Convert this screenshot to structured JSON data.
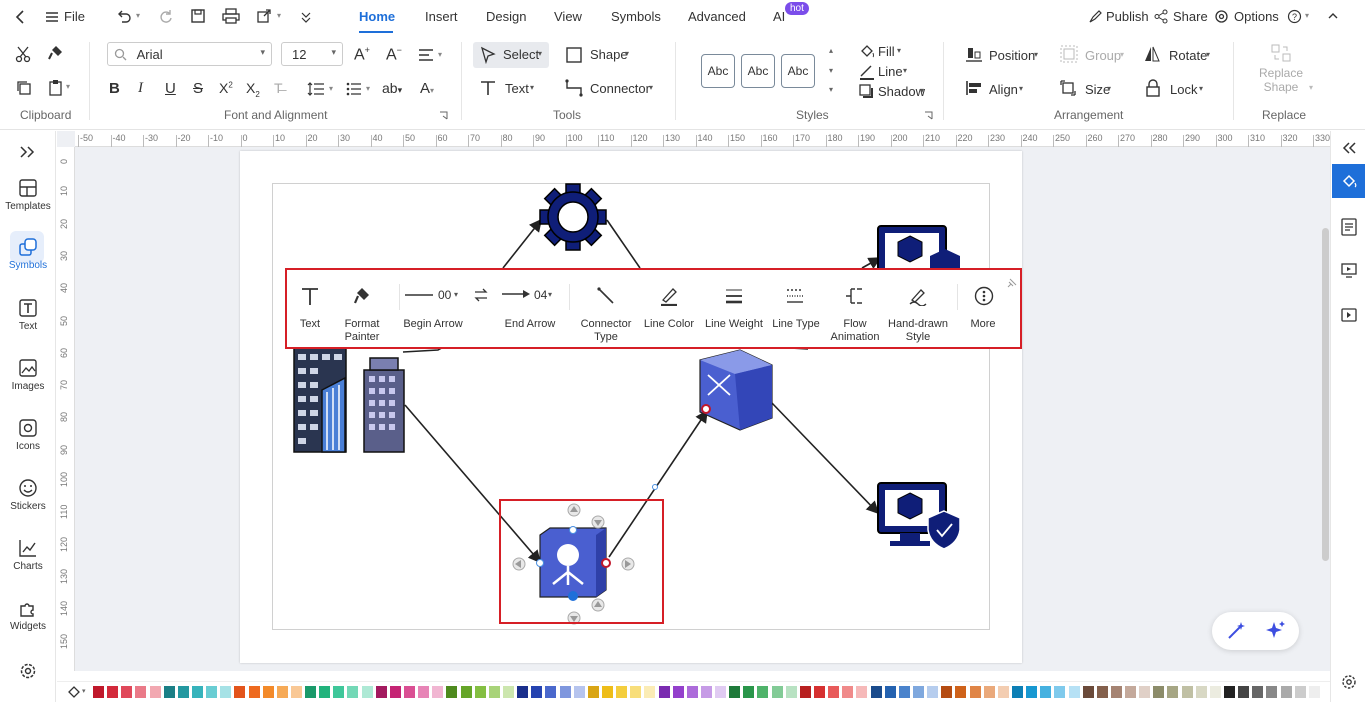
{
  "menubar": {
    "file": "File",
    "tabs": [
      "Home",
      "Insert",
      "Design",
      "View",
      "Symbols",
      "Advanced",
      "AI"
    ],
    "ai_badge": "hot",
    "publish": "Publish",
    "share": "Share",
    "options": "Options"
  },
  "ribbon": {
    "groups": [
      "Clipboard",
      "Font and Alignment",
      "Tools",
      "Styles",
      "Arrangement",
      "Replace"
    ],
    "font_family": "Arial",
    "font_size": "12",
    "select": "Select",
    "shape": "Shape",
    "text": "Text",
    "connector": "Connector",
    "style_sample": "Abc",
    "fill": "Fill",
    "line": "Line",
    "shadow": "Shadow",
    "position": "Position",
    "group": "Group",
    "rotate": "Rotate",
    "align": "Align",
    "size": "Size",
    "lock": "Lock",
    "replace_shape": "Replace Shape"
  },
  "leftbar": [
    "Templates",
    "Symbols",
    "Text",
    "Images",
    "Icons",
    "Stickers",
    "Charts",
    "Widgets"
  ],
  "ruler": {
    "h": [
      "-50",
      "-40",
      "-30",
      "-20",
      "-10",
      "0",
      "10",
      "20",
      "30",
      "40",
      "50",
      "60",
      "70",
      "80",
      "90",
      "100",
      "110",
      "120",
      "130",
      "140",
      "150",
      "160",
      "170",
      "180",
      "190",
      "200",
      "210",
      "220",
      "230",
      "240",
      "250",
      "260",
      "270",
      "280",
      "290",
      "300",
      "310",
      "320",
      "330"
    ],
    "v": [
      "0",
      "10",
      "20",
      "30",
      "40",
      "50",
      "60",
      "70",
      "80",
      "90",
      "100",
      "110",
      "120",
      "130",
      "140",
      "150"
    ]
  },
  "floatbar": {
    "text": "Text",
    "format_painter": "Format Painter",
    "begin_arrow": "Begin Arrow",
    "begin_arrow_value": "00",
    "end_arrow": "End Arrow",
    "end_arrow_value": "04",
    "connector_type": "Connector Type",
    "line_color": "Line Color",
    "line_weight": "Line Weight",
    "line_type": "Line Type",
    "flow_animation": "Flow Animation",
    "hand_drawn": "Hand-drawn Style",
    "more": "More"
  },
  "colors": {
    "accent": "#1e6fd9",
    "highlight": "#d61f26",
    "palette": [
      "#c0182b",
      "#d32a3b",
      "#e0485a",
      "#ea7a88",
      "#f2a8b1",
      "#1b7f86",
      "#2398a0",
      "#36b3bb",
      "#69cdd3",
      "#a6e2e6",
      "#e3541b",
      "#ee6a1f",
      "#f38a2a",
      "#f6aa57",
      "#f9c895",
      "#1a9a6a",
      "#22b37c",
      "#3fc79a",
      "#73d8b6",
      "#aee9d5",
      "#a31a5f",
      "#c52474",
      "#da4f93",
      "#e784b6",
      "#f1b6d2",
      "#4e8a1e",
      "#65a528",
      "#84bf42",
      "#a8d379",
      "#cce6ae",
      "#1a2f8c",
      "#2543b0",
      "#4a68cc",
      "#7f97de",
      "#b6c4ee",
      "#d9a514",
      "#eebd18",
      "#f4ce3d",
      "#f8de7a",
      "#fbecb5",
      "#7a2bb0",
      "#9440cc",
      "#ac6bda",
      "#c69be6",
      "#e0cbf2",
      "#1f7a3a",
      "#2a964a",
      "#4fb36a",
      "#82cb96",
      "#b8e2c2",
      "#b82020",
      "#d63030",
      "#e85a5a",
      "#f08a8a",
      "#f6b9b9",
      "#1a4b8c",
      "#2462b0",
      "#4a83cc",
      "#7fa8de",
      "#b6cdee",
      "#b54c12",
      "#cf621a",
      "#e08546",
      "#eaa97b",
      "#f3cdb1",
      "#0c7fb5",
      "#1798d1",
      "#45b1e0",
      "#7fcaec",
      "#b6e1f5",
      "#6b4a3a",
      "#84604c",
      "#a58372",
      "#c4a99b",
      "#e0d0c7",
      "#8c8c6a",
      "#a6a684",
      "#c0c0a4",
      "#d8d8c4",
      "#ecece0",
      "#222222",
      "#444444",
      "#666666",
      "#888888",
      "#aaaaaa",
      "#cccccc",
      "#eeeeee"
    ]
  }
}
